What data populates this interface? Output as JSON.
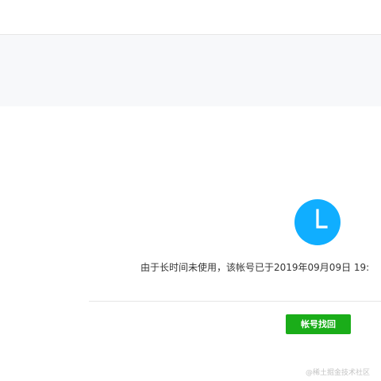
{
  "notice": {
    "icon": "clock-icon",
    "icon_color": "#10aeff",
    "message": "由于长时间未使用，该帐号已于2019年09月09日 19:"
  },
  "actions": {
    "recover_label": "帐号找回",
    "recover_color": "#1aad19"
  },
  "watermark": {
    "text": "@稀土掘金技术社区"
  }
}
